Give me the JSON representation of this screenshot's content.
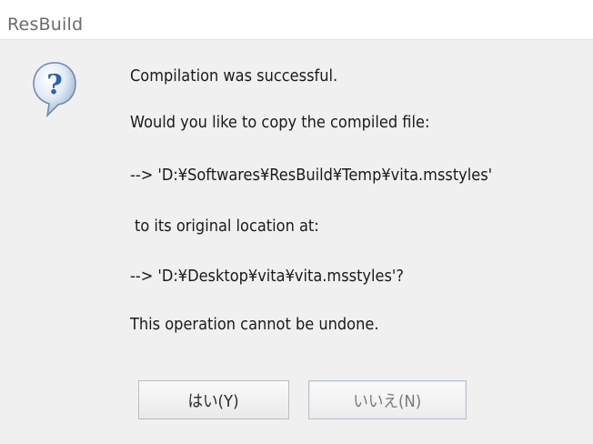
{
  "window": {
    "title": "ResBuild"
  },
  "message": {
    "line1": "Compilation was successful.",
    "line2": "Would you like to copy the compiled file:",
    "line3": "--> 'D:¥Softwares¥ResBuild¥Temp¥vita.msstyles'",
    "line4": "to its original location at:",
    "line5": "--> 'D:¥Desktop¥vita¥vita.msstyles'?",
    "line6": "This operation cannot be undone."
  },
  "icon": {
    "name": "question-icon",
    "glyph": "?",
    "color": "#2d62a8"
  },
  "buttons": {
    "yes_label": "はい(Y)",
    "no_label": "いいえ(N)"
  }
}
